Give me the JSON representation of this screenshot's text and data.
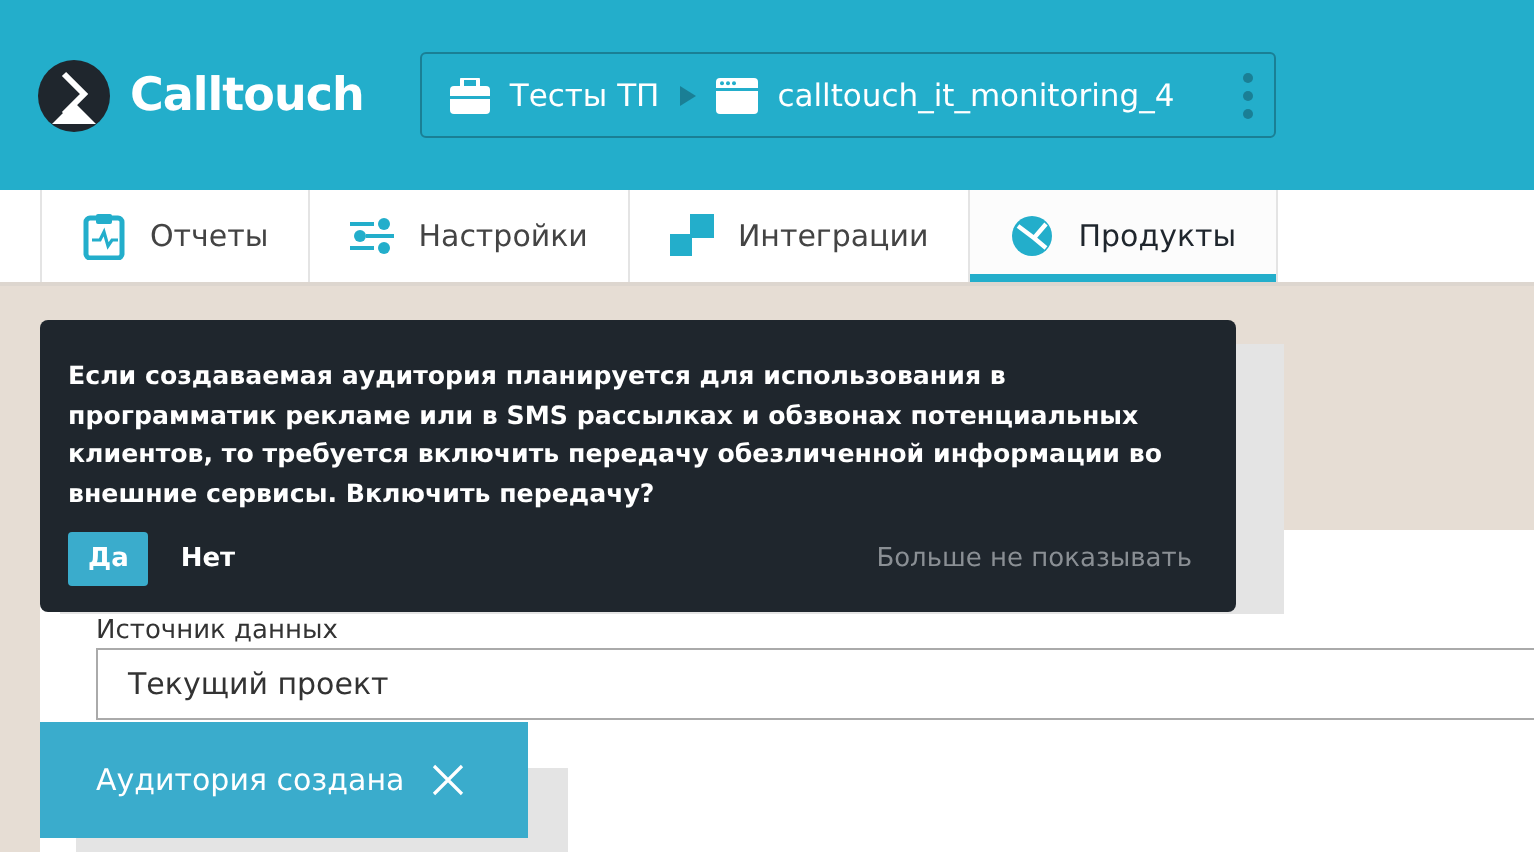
{
  "header": {
    "brand": "Calltouch",
    "breadcrumb": [
      {
        "kind": "folder",
        "label": "Тесты ТП"
      },
      {
        "kind": "site",
        "label": "calltouch_it_monitoring_4"
      }
    ]
  },
  "tabs": [
    {
      "label": "Отчеты",
      "kind": "report",
      "selected": false
    },
    {
      "label": "Настройки",
      "kind": "settings",
      "selected": false
    },
    {
      "label": "Интеграции",
      "kind": "integrations",
      "selected": false
    },
    {
      "label": "Продукты",
      "kind": "products",
      "selected": true
    }
  ],
  "form": {
    "label": "Источник данных",
    "value": "Текущий проект"
  },
  "popup": {
    "message": "Если создаваемая аудитория планируется для использования в программатик рекламе или в SMS рассылках и обзвонах потенциальных клиентов, то требуется включить передачу обезличенной информации во внешние сервисы. Включить передачу?",
    "buttons": [
      "Да",
      "Нет"
    ],
    "dismiss": "Больше не показывать"
  },
  "toast": {
    "message": "Аудитория создана"
  }
}
